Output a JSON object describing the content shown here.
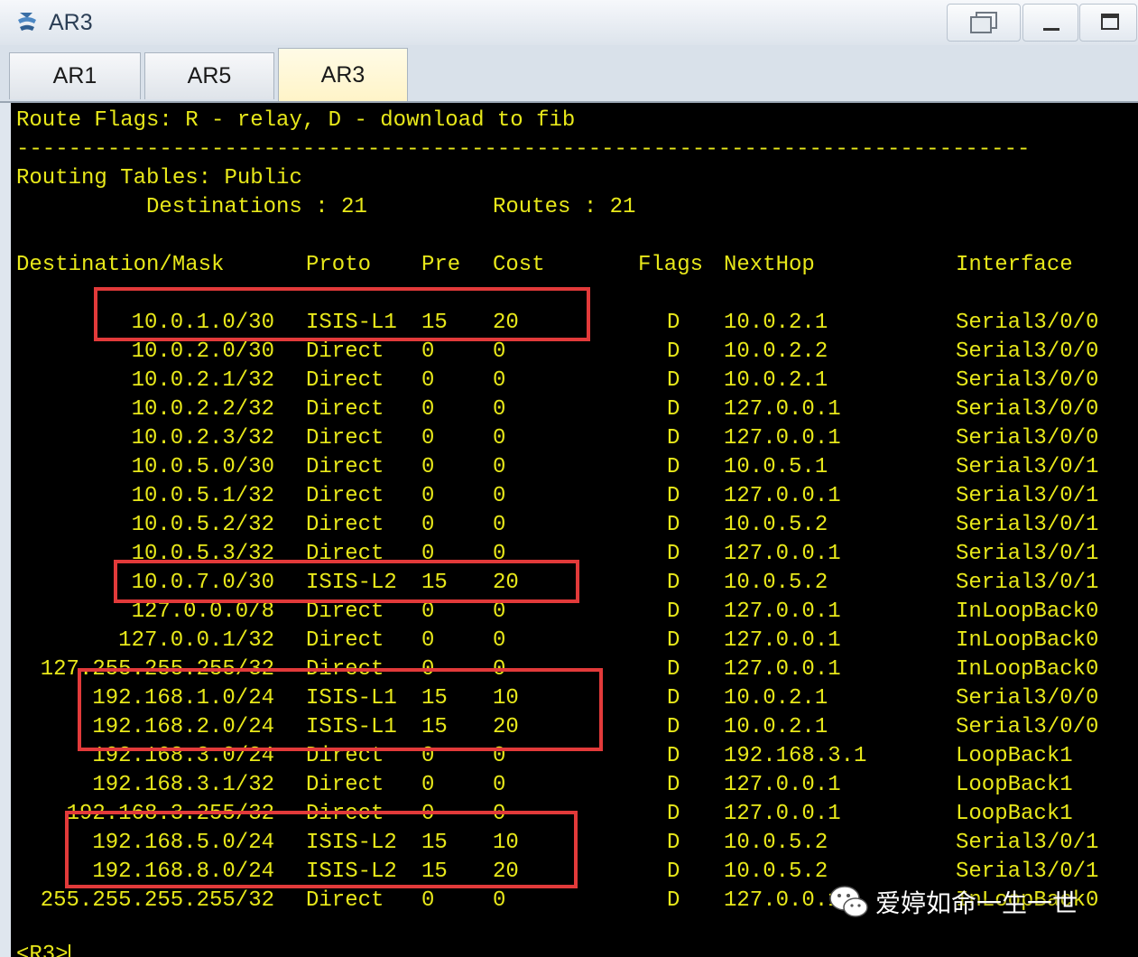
{
  "window": {
    "title": "AR3"
  },
  "tabs": [
    {
      "label": "AR1"
    },
    {
      "label": "AR5"
    },
    {
      "label": "AR3"
    }
  ],
  "terminal": {
    "flags_line": "Route Flags: R - relay, D - download to fib",
    "separator": "------------------------------------------------------------------------------",
    "tables_title": "Routing Tables: Public",
    "destinations_label": "Destinations : 21",
    "routes_label": "Routes : 21",
    "headers": {
      "dest": "Destination/Mask",
      "proto": "Proto",
      "pre": "Pre",
      "cost": "Cost",
      "flags": "Flags",
      "nexthop": "NextHop",
      "iface": "Interface"
    },
    "routes": [
      {
        "dest": "10.0.1.0/30",
        "proto": "ISIS-L1",
        "pre": "15",
        "cost": "20",
        "flags": "D",
        "nexthop": "10.0.2.1",
        "iface": "Serial3/0/0"
      },
      {
        "dest": "10.0.2.0/30",
        "proto": "Direct",
        "pre": "0",
        "cost": "0",
        "flags": "D",
        "nexthop": "10.0.2.2",
        "iface": "Serial3/0/0"
      },
      {
        "dest": "10.0.2.1/32",
        "proto": "Direct",
        "pre": "0",
        "cost": "0",
        "flags": "D",
        "nexthop": "10.0.2.1",
        "iface": "Serial3/0/0"
      },
      {
        "dest": "10.0.2.2/32",
        "proto": "Direct",
        "pre": "0",
        "cost": "0",
        "flags": "D",
        "nexthop": "127.0.0.1",
        "iface": "Serial3/0/0"
      },
      {
        "dest": "10.0.2.3/32",
        "proto": "Direct",
        "pre": "0",
        "cost": "0",
        "flags": "D",
        "nexthop": "127.0.0.1",
        "iface": "Serial3/0/0"
      },
      {
        "dest": "10.0.5.0/30",
        "proto": "Direct",
        "pre": "0",
        "cost": "0",
        "flags": "D",
        "nexthop": "10.0.5.1",
        "iface": "Serial3/0/1"
      },
      {
        "dest": "10.0.5.1/32",
        "proto": "Direct",
        "pre": "0",
        "cost": "0",
        "flags": "D",
        "nexthop": "127.0.0.1",
        "iface": "Serial3/0/1"
      },
      {
        "dest": "10.0.5.2/32",
        "proto": "Direct",
        "pre": "0",
        "cost": "0",
        "flags": "D",
        "nexthop": "10.0.5.2",
        "iface": "Serial3/0/1"
      },
      {
        "dest": "10.0.5.3/32",
        "proto": "Direct",
        "pre": "0",
        "cost": "0",
        "flags": "D",
        "nexthop": "127.0.0.1",
        "iface": "Serial3/0/1"
      },
      {
        "dest": "10.0.7.0/30",
        "proto": "ISIS-L2",
        "pre": "15",
        "cost": "20",
        "flags": "D",
        "nexthop": "10.0.5.2",
        "iface": "Serial3/0/1"
      },
      {
        "dest": "127.0.0.0/8",
        "proto": "Direct",
        "pre": "0",
        "cost": "0",
        "flags": "D",
        "nexthop": "127.0.0.1",
        "iface": "InLoopBack0"
      },
      {
        "dest": "127.0.0.1/32",
        "proto": "Direct",
        "pre": "0",
        "cost": "0",
        "flags": "D",
        "nexthop": "127.0.0.1",
        "iface": "InLoopBack0"
      },
      {
        "dest": "127.255.255.255/32",
        "proto": "Direct",
        "pre": "0",
        "cost": "0",
        "flags": "D",
        "nexthop": "127.0.0.1",
        "iface": "InLoopBack0"
      },
      {
        "dest": "192.168.1.0/24",
        "proto": "ISIS-L1",
        "pre": "15",
        "cost": "10",
        "flags": "D",
        "nexthop": "10.0.2.1",
        "iface": "Serial3/0/0"
      },
      {
        "dest": "192.168.2.0/24",
        "proto": "ISIS-L1",
        "pre": "15",
        "cost": "20",
        "flags": "D",
        "nexthop": "10.0.2.1",
        "iface": "Serial3/0/0"
      },
      {
        "dest": "192.168.3.0/24",
        "proto": "Direct",
        "pre": "0",
        "cost": "0",
        "flags": "D",
        "nexthop": "192.168.3.1",
        "iface": "LoopBack1"
      },
      {
        "dest": "192.168.3.1/32",
        "proto": "Direct",
        "pre": "0",
        "cost": "0",
        "flags": "D",
        "nexthop": "127.0.0.1",
        "iface": "LoopBack1"
      },
      {
        "dest": "192.168.3.255/32",
        "proto": "Direct",
        "pre": "0",
        "cost": "0",
        "flags": "D",
        "nexthop": "127.0.0.1",
        "iface": "LoopBack1"
      },
      {
        "dest": "192.168.5.0/24",
        "proto": "ISIS-L2",
        "pre": "15",
        "cost": "10",
        "flags": "D",
        "nexthop": "10.0.5.2",
        "iface": "Serial3/0/1"
      },
      {
        "dest": "192.168.8.0/24",
        "proto": "ISIS-L2",
        "pre": "15",
        "cost": "20",
        "flags": "D",
        "nexthop": "10.0.5.2",
        "iface": "Serial3/0/1"
      },
      {
        "dest": "255.255.255.255/32",
        "proto": "Direct",
        "pre": "0",
        "cost": "0",
        "flags": "D",
        "nexthop": "127.0.0.1",
        "iface": "InLoopBack0"
      }
    ],
    "prompt": "<R3>"
  },
  "watermark": {
    "text": "爱婷如命一生一世"
  },
  "colors": {
    "terminal_text": "#e8e81a",
    "highlight": "#e23a3a"
  }
}
